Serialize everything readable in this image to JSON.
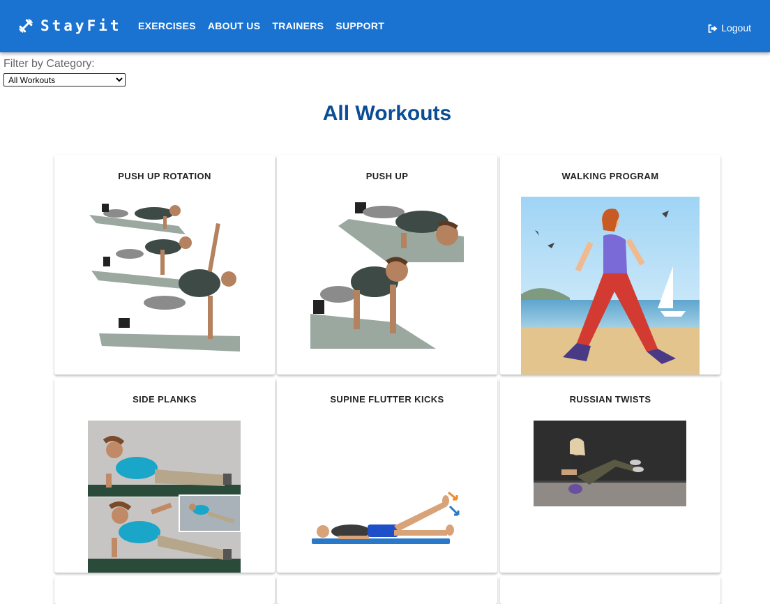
{
  "app": {
    "brand": "StayFit",
    "nav": [
      "EXERCISES",
      "ABOUT US",
      "TRAINERS",
      "SUPPORT"
    ],
    "logout_label": "Logout"
  },
  "filter": {
    "label": "Filter by Category:",
    "selected": "All Workouts"
  },
  "page": {
    "title": "All Workouts"
  },
  "workouts": [
    {
      "title": "PUSH UP ROTATION",
      "icon": "push-up-rotation-illustration"
    },
    {
      "title": "PUSH UP",
      "icon": "push-up-illustration"
    },
    {
      "title": "WALKING PROGRAM",
      "icon": "walking-illustration"
    },
    {
      "title": "SIDE PLANKS",
      "icon": "side-plank-photo"
    },
    {
      "title": "SUPINE FLUTTER KICKS",
      "icon": "flutter-kicks-illustration"
    },
    {
      "title": "RUSSIAN TWISTS",
      "icon": "russian-twist-photo"
    }
  ],
  "colors": {
    "navbar": "#1a73d1",
    "title": "#0a4d94"
  }
}
